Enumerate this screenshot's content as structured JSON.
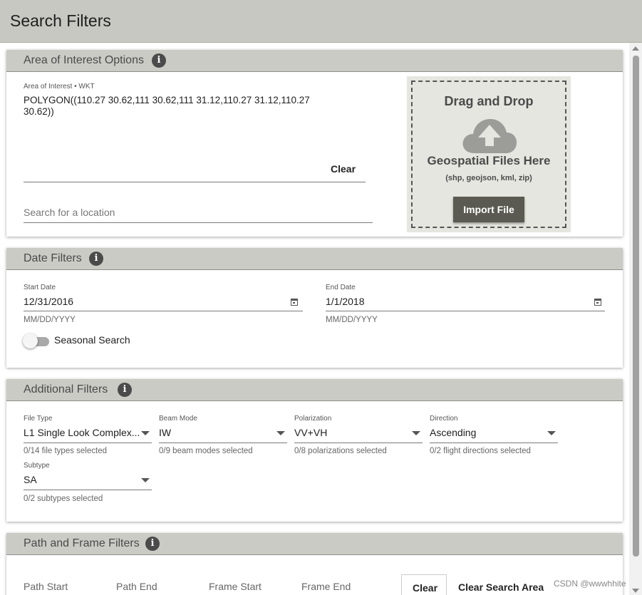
{
  "header": {
    "title": "Search Filters"
  },
  "aoi": {
    "title": "Area of Interest Options",
    "info": "i",
    "wkt_label": "Area of Interest • WKT",
    "wkt_value": "POLYGON((110.27 30.62,111 30.62,111 31.12,110.27 31.12,110.27 30.62))",
    "clear_label": "Clear",
    "location_placeholder": "Search for a location",
    "dropzone": {
      "title": "Drag and Drop",
      "subtitle": "Geospatial Files Here",
      "formats": "(shp, geojson, kml, zip)",
      "import_label": "Import File"
    }
  },
  "dates": {
    "title": "Date Filters",
    "info": "i",
    "start": {
      "label": "Start Date",
      "value": "12/31/2016",
      "hint": "MM/DD/YYYY"
    },
    "end": {
      "label": "End Date",
      "value": "1/1/2018",
      "hint": "MM/DD/YYYY"
    },
    "seasonal_label": "Seasonal Search"
  },
  "additional": {
    "title": "Additional Filters",
    "info": "i",
    "file_type": {
      "label": "File Type",
      "value": "L1 Single Look Complex...",
      "hint": "0/14 file types selected"
    },
    "beam_mode": {
      "label": "Beam Mode",
      "value": "IW",
      "hint": "0/9 beam modes selected"
    },
    "polarization": {
      "label": "Polarization",
      "value": "VV+VH",
      "hint": "0/8 polarizations selected"
    },
    "direction": {
      "label": "Direction",
      "value": "Ascending",
      "hint": "0/2 flight directions selected"
    },
    "subtype": {
      "label": "Subtype",
      "value": "SA",
      "hint": "0/2 subtypes selected"
    }
  },
  "path_frame": {
    "title": "Path and Frame Filters",
    "info": "i",
    "path_start": "Path Start",
    "path_end": "Path End",
    "frame_start": "Frame Start",
    "frame_end": "Frame End",
    "clear_label": "Clear",
    "clear_area_label": "Clear Search Area"
  },
  "watermark": "CSDN @wwwhhite",
  "colors": {
    "header_bg": "#c8c8c2",
    "card_header_bg": "#cbcbc5",
    "import_button": "#5a5a52",
    "dropzone_bg": "#e6e6e0"
  }
}
